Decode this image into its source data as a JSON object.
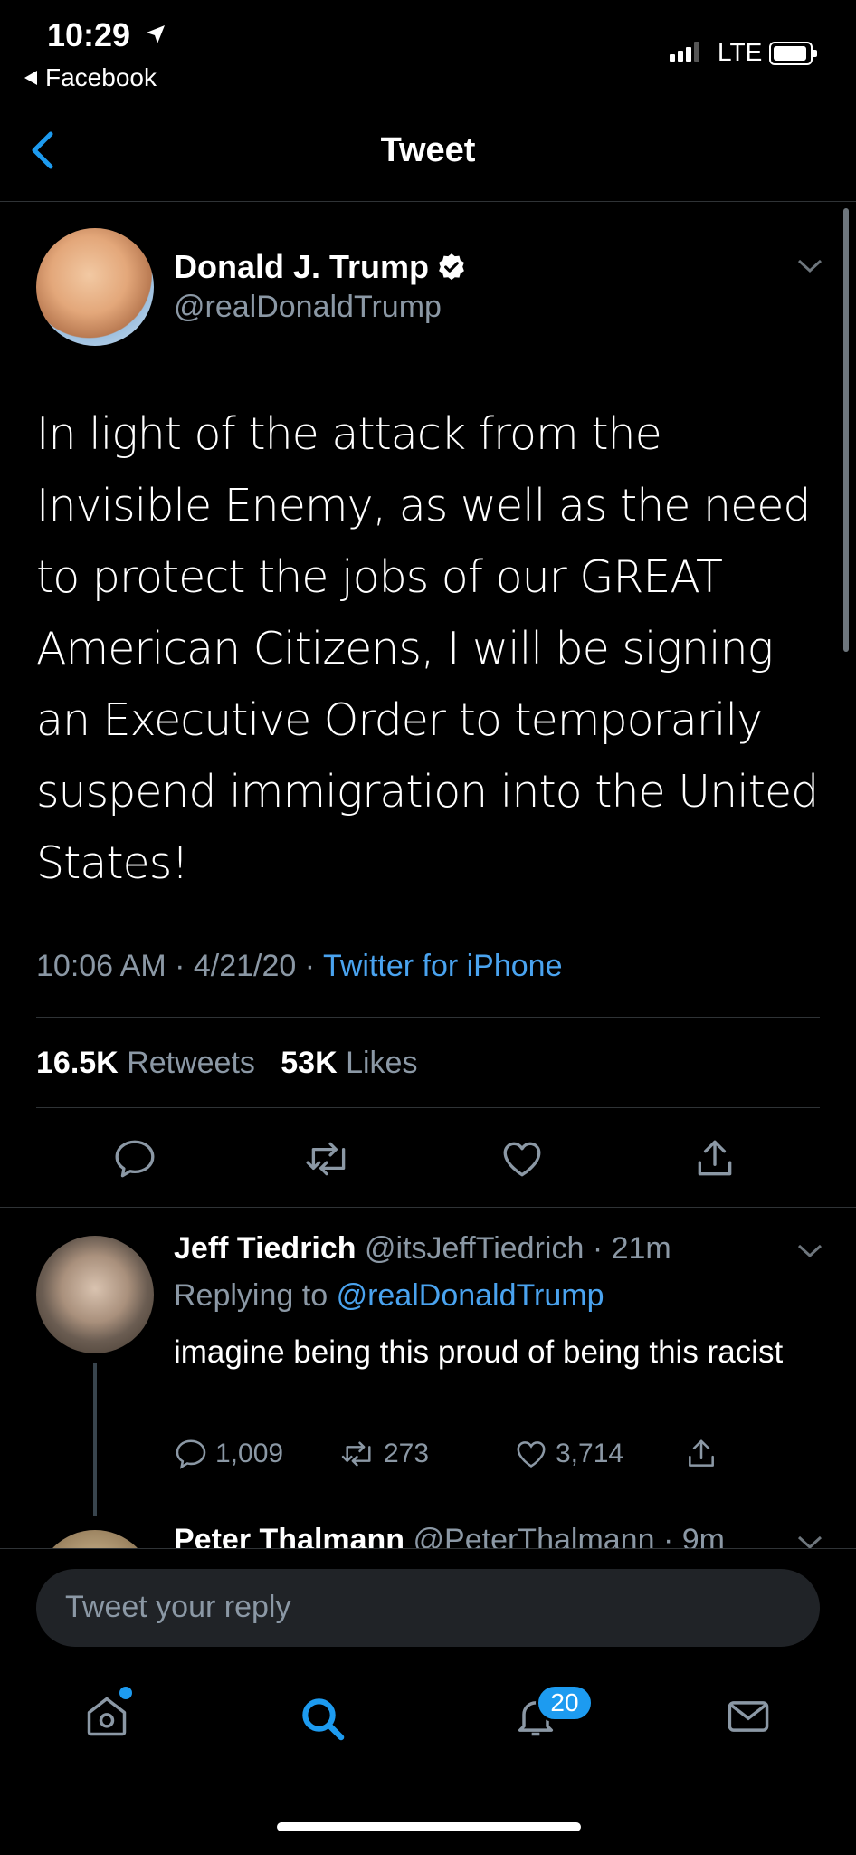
{
  "status_bar": {
    "time": "10:29",
    "back_app": "Facebook",
    "network": "LTE"
  },
  "header": {
    "title": "Tweet"
  },
  "tweet": {
    "author_name": "Donald J. Trump",
    "author_handle": "@realDonaldTrump",
    "text": "In light of the attack from the Invisible Enemy, as well as the need to protect the jobs of our GREAT American Citizens, I will be signing an Executive Order to temporarily suspend immigration into the United States!",
    "time": "10:06 AM",
    "date": "4/21/20",
    "source": "Twitter for iPhone",
    "retweets_count": "16.5K",
    "retweets_label": "Retweets",
    "likes_count": "53K",
    "likes_label": "Likes"
  },
  "reply": {
    "author_name": "Jeff Tiedrich",
    "author_handle": "@itsJeffTiedrich · 21m",
    "replying_prefix": "Replying to",
    "replying_handle": "@realDonaldTrump",
    "text": "imagine being this proud of being this racist",
    "replies": "1,009",
    "retweets": "273",
    "likes": "3,714"
  },
  "next_reply": {
    "author_name": "Peter Thalmann",
    "author_handle": "@PeterThalmann · 9m"
  },
  "composer": {
    "placeholder": "Tweet your reply"
  },
  "tab_bar": {
    "notifications_badge": "20"
  },
  "colors": {
    "accent": "#1d9bf0",
    "link": "#4aa3ef",
    "secondary_text": "#8b98a5",
    "background": "#000000"
  },
  "icons": [
    "location-arrow-icon",
    "back-triangle-icon",
    "verified-badge-icon",
    "chevron-down-icon",
    "reply-icon",
    "retweet-icon",
    "like-icon",
    "share-icon",
    "home-icon",
    "search-icon",
    "notifications-icon",
    "messages-icon"
  ]
}
